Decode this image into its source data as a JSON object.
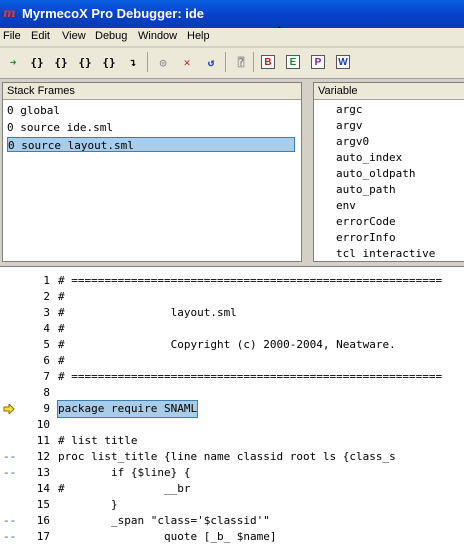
{
  "window": {
    "title": "MyrmecoX Pro Debugger: ide"
  },
  "menu": [
    "File",
    "Edit",
    "View",
    "Debug",
    "Window",
    "Help"
  ],
  "toolbar": {
    "buttons": [
      {
        "name": "run-icon",
        "glyph": "➜"
      },
      {
        "name": "step-into-icon",
        "glyph": "{}"
      },
      {
        "name": "step-over-icon",
        "glyph": "{}"
      },
      {
        "name": "step-out-icon",
        "glyph": "{}"
      },
      {
        "name": "step-next-icon",
        "glyph": "{}"
      },
      {
        "name": "step-return-icon",
        "glyph": "↴"
      },
      {
        "name": "breakpoint-icon",
        "glyph": "◎"
      },
      {
        "name": "stop-icon",
        "glyph": "✕"
      },
      {
        "name": "restart-icon",
        "glyph": "↺"
      },
      {
        "name": "inspect-icon",
        "glyph": "⍰"
      }
    ],
    "letter_buttons": [
      "B",
      "E",
      "P",
      "W"
    ],
    "letter_colors": [
      "#c0201a",
      "#178a2e",
      "#7a1aa0",
      "#1a3cc0"
    ]
  },
  "stack_frames": {
    "header": "Stack Frames",
    "rows": [
      "0 global",
      "0 source ide.sml",
      "0 source layout.sml"
    ],
    "selected_index": 2
  },
  "variables": {
    "header": "Variable",
    "rows": [
      "argc",
      "argv",
      "argv0",
      "auto_index",
      "auto_oldpath",
      "auto_path",
      "env",
      "errorCode",
      "errorInfo",
      "tcl interactive"
    ]
  },
  "editor": {
    "lines": [
      {
        "n": "1",
        "mark": "",
        "code": "# ========================================================"
      },
      {
        "n": "2",
        "mark": "",
        "code": "#"
      },
      {
        "n": "3",
        "mark": "",
        "code": "#                layout.sml"
      },
      {
        "n": "4",
        "mark": "",
        "code": "#"
      },
      {
        "n": "5",
        "mark": "",
        "code": "#                Copyright (c) 2000-2004, Neatware."
      },
      {
        "n": "6",
        "mark": "",
        "code": "#"
      },
      {
        "n": "7",
        "mark": "",
        "code": "# ========================================================"
      },
      {
        "n": "8",
        "mark": "",
        "code": ""
      },
      {
        "n": "9",
        "mark": "arrow",
        "code": "package require SNAML"
      },
      {
        "n": "10",
        "mark": "",
        "code": ""
      },
      {
        "n": "11",
        "mark": "",
        "code": "# list title"
      },
      {
        "n": "12",
        "mark": "--",
        "code": "proc list_title {line name classid root ls {class_s"
      },
      {
        "n": "13",
        "mark": "--",
        "code": "        if {$line} {"
      },
      {
        "n": "14",
        "mark": "",
        "code": "#               __br"
      },
      {
        "n": "15",
        "mark": "",
        "code": "        }"
      },
      {
        "n": "16",
        "mark": "--",
        "code": "        _span \"class='$classid'\""
      },
      {
        "n": "17",
        "mark": "--",
        "code": "                quote [_b_ $name]"
      }
    ],
    "current_line": 9
  }
}
